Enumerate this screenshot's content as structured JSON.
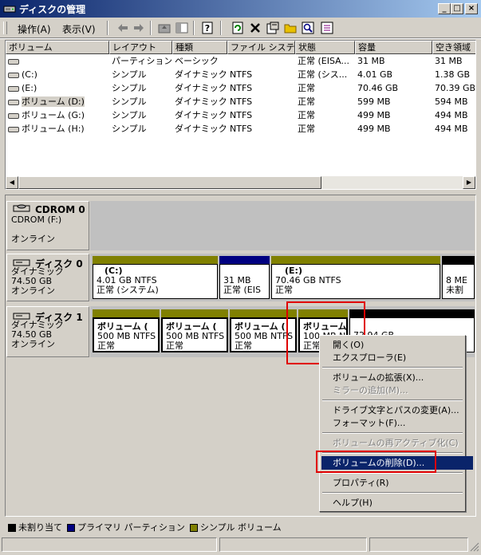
{
  "window": {
    "title": "ディスクの管理"
  },
  "menu": {
    "action": "操作(A)",
    "view": "表示(V)"
  },
  "columns": [
    "ボリューム",
    "レイアウト",
    "種類",
    "ファイル システム",
    "状態",
    "容量",
    "空き領域"
  ],
  "volumes": [
    {
      "name": "",
      "layout": "パーティション",
      "type": "ベーシック",
      "fs": "",
      "status": "正常 (EISA...",
      "capacity": "31 MB",
      "free": "31 MB"
    },
    {
      "name": "(C:)",
      "layout": "シンプル",
      "type": "ダイナミック",
      "fs": "NTFS",
      "status": "正常 (シス...",
      "capacity": "4.01 GB",
      "free": "1.38 GB"
    },
    {
      "name": "(E:)",
      "layout": "シンプル",
      "type": "ダイナミック",
      "fs": "NTFS",
      "status": "正常",
      "capacity": "70.46 GB",
      "free": "70.39 GB"
    },
    {
      "name": "ボリューム (D:)",
      "layout": "シンプル",
      "type": "ダイナミック",
      "fs": "NTFS",
      "status": "正常",
      "capacity": "599 MB",
      "free": "594 MB"
    },
    {
      "name": "ボリューム (G:)",
      "layout": "シンプル",
      "type": "ダイナミック",
      "fs": "NTFS",
      "status": "正常",
      "capacity": "499 MB",
      "free": "494 MB"
    },
    {
      "name": "ボリューム (H:)",
      "layout": "シンプル",
      "type": "ダイナミック",
      "fs": "NTFS",
      "status": "正常",
      "capacity": "499 MB",
      "free": "494 MB"
    }
  ],
  "disks": {
    "cdrom": {
      "name": "CDROM 0",
      "sub1": "CDROM (F:)",
      "sub2": "オンライン"
    },
    "disk0": {
      "name": "ディスク 0",
      "type": "ダイナミック",
      "size": "74.50 GB",
      "state": "オンライン",
      "parts": [
        {
          "title": "(C:)",
          "line1": "4.01 GB NTFS",
          "line2": "正常 (システム)"
        },
        {
          "title": "",
          "line1": "31 MB",
          "line2": "正常 (EIS"
        },
        {
          "title": "(E:)",
          "line1": "70.46 GB NTFS",
          "line2": "正常"
        },
        {
          "title": "",
          "line1": "8 ME",
          "line2": "未割"
        }
      ]
    },
    "disk1": {
      "name": "ディスク 1",
      "type": "ダイナミック",
      "size": "74.50 GB",
      "state": "オンライン",
      "parts": [
        {
          "title": "ボリューム (",
          "line1": "500 MB NTFS",
          "line2": "正常"
        },
        {
          "title": "ボリューム (",
          "line1": "500 MB NTFS",
          "line2": "正常"
        },
        {
          "title": "ボリューム (",
          "line1": "500 MB NTFS",
          "line2": "正常"
        },
        {
          "title": "ボリューム",
          "line1": "100 MB N",
          "line2": "正常"
        },
        {
          "title": "",
          "line1": "72.94 GB",
          "line2": ""
        }
      ]
    }
  },
  "context_menu": {
    "open": "開く(O)",
    "explore": "エクスプローラ(E)",
    "extend": "ボリュームの拡張(X)...",
    "mirror": "ミラーの追加(M)...",
    "change_letter": "ドライブ文字とパスの変更(A)...",
    "format": "フォーマット(F)...",
    "reactivate": "ボリュームの再アクティブ化(C)",
    "delete": "ボリュームの削除(D)...",
    "properties": "プロパティ(R)",
    "help": "ヘルプ(H)"
  },
  "legend": {
    "unallocated": "未割り当て",
    "primary": "プライマリ パーティション",
    "simple": "シンプル ボリューム"
  },
  "colors": {
    "simple": "#808000",
    "primary": "#000080",
    "unallocated": "#000000",
    "highlight": "#0a246a",
    "annotation": "#e00000"
  }
}
